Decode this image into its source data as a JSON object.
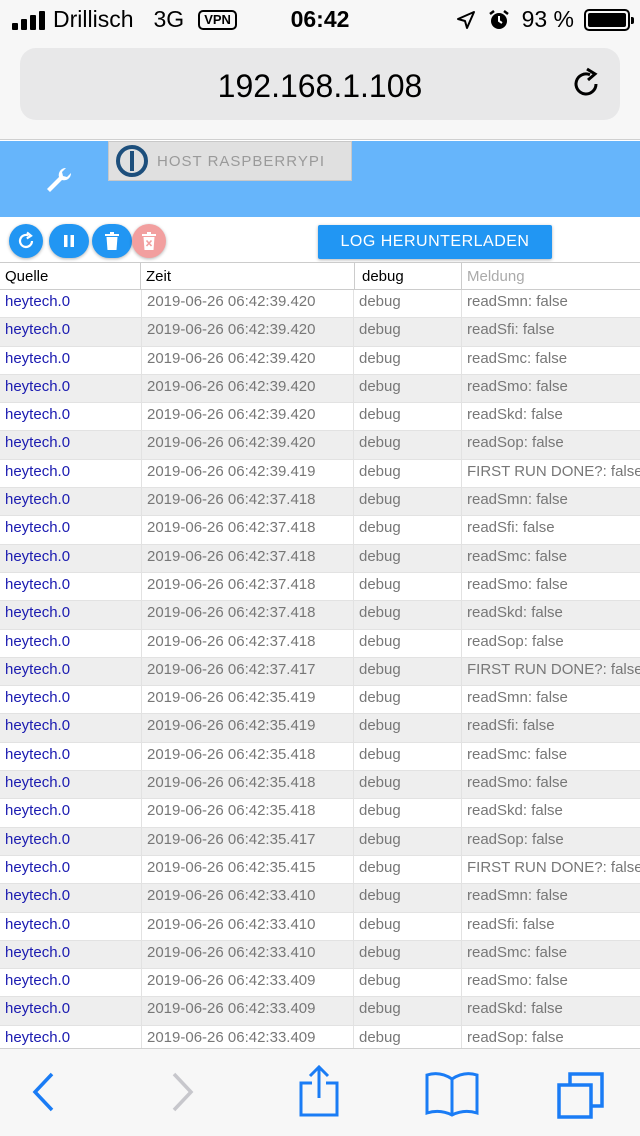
{
  "statusbar": {
    "carrier": "Drillisch",
    "network": "3G",
    "vpn": "VPN",
    "time": "06:42",
    "battery": "93 %"
  },
  "browser": {
    "url": "192.168.1.108"
  },
  "header": {
    "host_label": "HOST RASPBERRYPI"
  },
  "toolbar": {
    "download_label": "LOG HERUNTERLADEN"
  },
  "table": {
    "columns": {
      "source": "Quelle",
      "time": "Zeit",
      "severity": "debug",
      "message": "Meldung"
    },
    "rows": [
      {
        "source": "heytech.0",
        "time": "2019-06-26 06:42:39.420",
        "severity": "debug",
        "message": "readSmn: false"
      },
      {
        "source": "heytech.0",
        "time": "2019-06-26 06:42:39.420",
        "severity": "debug",
        "message": "readSfi: false"
      },
      {
        "source": "heytech.0",
        "time": "2019-06-26 06:42:39.420",
        "severity": "debug",
        "message": "readSmc: false"
      },
      {
        "source": "heytech.0",
        "time": "2019-06-26 06:42:39.420",
        "severity": "debug",
        "message": "readSmo: false"
      },
      {
        "source": "heytech.0",
        "time": "2019-06-26 06:42:39.420",
        "severity": "debug",
        "message": "readSkd: false"
      },
      {
        "source": "heytech.0",
        "time": "2019-06-26 06:42:39.420",
        "severity": "debug",
        "message": "readSop: false"
      },
      {
        "source": "heytech.0",
        "time": "2019-06-26 06:42:39.419",
        "severity": "debug",
        "message": "FIRST RUN DONE?: false"
      },
      {
        "source": "heytech.0",
        "time": "2019-06-26 06:42:37.418",
        "severity": "debug",
        "message": "readSmn: false"
      },
      {
        "source": "heytech.0",
        "time": "2019-06-26 06:42:37.418",
        "severity": "debug",
        "message": "readSfi: false"
      },
      {
        "source": "heytech.0",
        "time": "2019-06-26 06:42:37.418",
        "severity": "debug",
        "message": "readSmc: false"
      },
      {
        "source": "heytech.0",
        "time": "2019-06-26 06:42:37.418",
        "severity": "debug",
        "message": "readSmo: false"
      },
      {
        "source": "heytech.0",
        "time": "2019-06-26 06:42:37.418",
        "severity": "debug",
        "message": "readSkd: false"
      },
      {
        "source": "heytech.0",
        "time": "2019-06-26 06:42:37.418",
        "severity": "debug",
        "message": "readSop: false"
      },
      {
        "source": "heytech.0",
        "time": "2019-06-26 06:42:37.417",
        "severity": "debug",
        "message": "FIRST RUN DONE?: false"
      },
      {
        "source": "heytech.0",
        "time": "2019-06-26 06:42:35.419",
        "severity": "debug",
        "message": "readSmn: false"
      },
      {
        "source": "heytech.0",
        "time": "2019-06-26 06:42:35.419",
        "severity": "debug",
        "message": "readSfi: false"
      },
      {
        "source": "heytech.0",
        "time": "2019-06-26 06:42:35.418",
        "severity": "debug",
        "message": "readSmc: false"
      },
      {
        "source": "heytech.0",
        "time": "2019-06-26 06:42:35.418",
        "severity": "debug",
        "message": "readSmo: false"
      },
      {
        "source": "heytech.0",
        "time": "2019-06-26 06:42:35.418",
        "severity": "debug",
        "message": "readSkd: false"
      },
      {
        "source": "heytech.0",
        "time": "2019-06-26 06:42:35.417",
        "severity": "debug",
        "message": "readSop: false"
      },
      {
        "source": "heytech.0",
        "time": "2019-06-26 06:42:35.415",
        "severity": "debug",
        "message": "FIRST RUN DONE?: false"
      },
      {
        "source": "heytech.0",
        "time": "2019-06-26 06:42:33.410",
        "severity": "debug",
        "message": "readSmn: false"
      },
      {
        "source": "heytech.0",
        "time": "2019-06-26 06:42:33.410",
        "severity": "debug",
        "message": "readSfi: false"
      },
      {
        "source": "heytech.0",
        "time": "2019-06-26 06:42:33.410",
        "severity": "debug",
        "message": "readSmc: false"
      },
      {
        "source": "heytech.0",
        "time": "2019-06-26 06:42:33.409",
        "severity": "debug",
        "message": "readSmo: false"
      },
      {
        "source": "heytech.0",
        "time": "2019-06-26 06:42:33.409",
        "severity": "debug",
        "message": "readSkd: false"
      },
      {
        "source": "heytech.0",
        "time": "2019-06-26 06:42:33.409",
        "severity": "debug",
        "message": "readSop: false"
      }
    ]
  },
  "icons": {
    "reload": "reload-icon",
    "wrench": "wrench-icon",
    "refresh": "refresh-icon",
    "pause": "pause-icon",
    "trash": "trash-icon",
    "clear": "trash-x-icon",
    "back": "chevron-left-icon",
    "forward": "chevron-right-icon",
    "share": "share-icon",
    "bookmarks": "book-icon",
    "tabs": "tabs-icon"
  },
  "colors": {
    "header": "#66b5fb",
    "button": "#2196f3",
    "disabled_button": "#f29f9f",
    "source_text": "#1a1ab0",
    "ios_blue": "#1a7cf5"
  }
}
